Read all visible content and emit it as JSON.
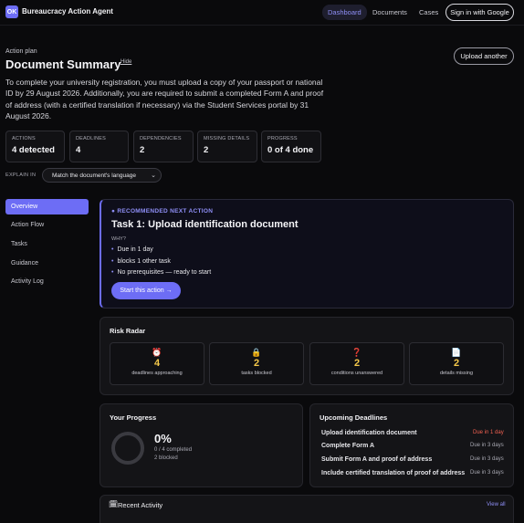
{
  "nav": {
    "brand": "Bureaucracy Action Agent",
    "logo": "OK",
    "links": [
      "Dashboard",
      "Documents",
      "Cases"
    ],
    "signin": "Sign in with Google"
  },
  "header": {
    "eyebrow": "Action plan",
    "title": "Document Summary",
    "hide": "Hide",
    "upload": "Upload another",
    "summary": "To complete your university registration, you must upload a copy of your passport or national ID by 29 August 2026. Additionally, you are required to submit a completed Form A and proof of address (with a certified translation if necessary) via the Student Services portal by 31 August 2026."
  },
  "stats": [
    {
      "label": "ACTIONS",
      "value": "4 detected"
    },
    {
      "label": "DEADLINES",
      "value": "4"
    },
    {
      "label": "DEPENDENCIES",
      "value": "2"
    },
    {
      "label": "MISSING DETAILS",
      "value": "2"
    },
    {
      "label": "PROGRESS",
      "value": "0 of 4 done"
    }
  ],
  "explain": {
    "label": "EXPLAIN IN",
    "selected": "Match the document's language",
    "chevron": "⌄"
  },
  "sidebar": {
    "items": [
      "Overview",
      "Action Flow",
      "Tasks",
      "Guidance",
      "Activity Log"
    ],
    "active": 0
  },
  "recommended": {
    "eyebrow": "● RECOMMENDED NEXT ACTION",
    "title": "Task 1: Upload identification document",
    "why": "WHY?",
    "bullet": "•",
    "reasons": [
      "Due in 1 day",
      "blocks 1 other task",
      "No prerequisites — ready to start"
    ],
    "button": "Start this action →"
  },
  "risk": {
    "title": "Risk Radar",
    "items": [
      {
        "icon": "⏰",
        "icon_name": "alarm-clock-icon",
        "value": "4",
        "label": "deadlines approaching"
      },
      {
        "icon": "🔒",
        "icon_name": "lock-icon",
        "value": "2",
        "label": "tasks blocked"
      },
      {
        "icon": "❓",
        "icon_name": "question-icon",
        "value": "2",
        "label": "conditions unanswered"
      },
      {
        "icon": "📄",
        "icon_name": "document-icon",
        "value": "2",
        "label": "details missing"
      }
    ]
  },
  "progress": {
    "title": "Your Progress",
    "percent": "0%",
    "completed": "0 / 4 completed",
    "blocked": "2 blocked"
  },
  "deadlines": {
    "title": "Upcoming Deadlines",
    "items": [
      {
        "name": "Upload identification document",
        "due": "Due in 1 day",
        "urgent": true
      },
      {
        "name": "Complete Form A",
        "due": "Due in 3 days",
        "urgent": false
      },
      {
        "name": "Submit Form A and proof of address",
        "due": "Due in 3 days",
        "urgent": false
      },
      {
        "name": "Include certified translation of proof of address",
        "due": "Due in 3 days",
        "urgent": false
      }
    ]
  },
  "activity": {
    "icon": "🗓",
    "title": "Recent Activity",
    "view_all": "View all"
  },
  "colors": {
    "accent": "#6d6df5",
    "warning": "#f4c84a",
    "urgent": "#f06050"
  }
}
